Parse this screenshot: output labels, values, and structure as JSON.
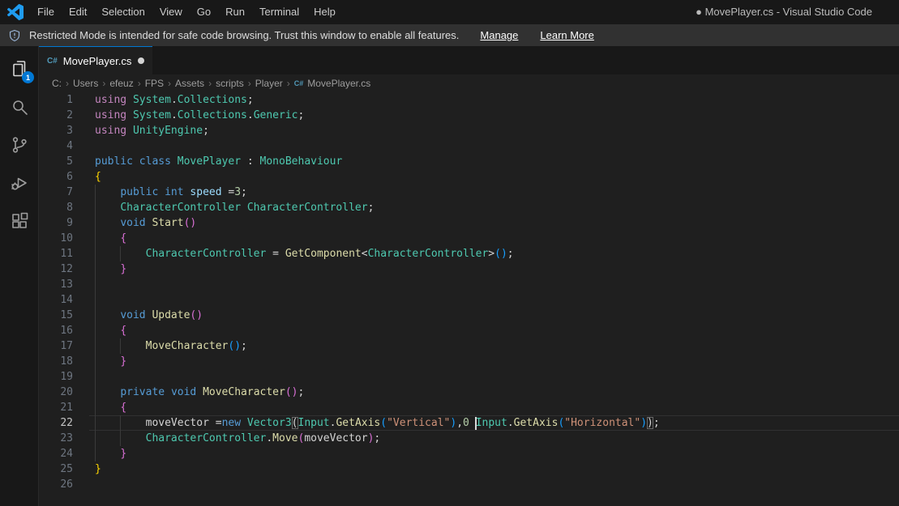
{
  "window": {
    "title": "● MovePlayer.cs - Visual Studio Code"
  },
  "menu": {
    "items": [
      "File",
      "Edit",
      "Selection",
      "View",
      "Go",
      "Run",
      "Terminal",
      "Help"
    ]
  },
  "banner": {
    "message": "Restricted Mode is intended for safe code browsing. Trust this window to enable all features.",
    "links": [
      "Manage",
      "Learn More"
    ]
  },
  "activity_bar": {
    "items": [
      "explorer",
      "search",
      "source-control",
      "run-and-debug",
      "extensions"
    ],
    "explorer_badge": "1"
  },
  "tab": {
    "label": "MovePlayer.cs",
    "icon": "csharp-file-icon",
    "modified": true
  },
  "breadcrumb": {
    "items": [
      "C:",
      "Users",
      "efeuz",
      "FPS",
      "Assets",
      "scripts",
      "Player",
      "MovePlayer.cs"
    ]
  },
  "colors": {
    "fg": "#d4d4d4",
    "kw": "#569cd6",
    "ctl": "#c586c0",
    "type": "#4ec9b0",
    "fn": "#dcdcaa",
    "str": "#ce9178",
    "num": "#b5cea8",
    "var": "#9cdcfe",
    "b1": "#ffd700",
    "b2": "#da70d6",
    "b3": "#179fff",
    "accent": "#0078d4",
    "cs_icon": "#519aba"
  },
  "editor": {
    "lines": [
      {
        "n": 1,
        "g": [],
        "t": [
          [
            "using",
            "ctl"
          ],
          [
            " ",
            "fg"
          ],
          [
            "System",
            "type"
          ],
          [
            ".",
            "fg"
          ],
          [
            "Collections",
            "type"
          ],
          [
            ";",
            "fg"
          ]
        ]
      },
      {
        "n": 2,
        "g": [],
        "t": [
          [
            "using",
            "ctl"
          ],
          [
            " ",
            "fg"
          ],
          [
            "System",
            "type"
          ],
          [
            ".",
            "fg"
          ],
          [
            "Collections",
            "type"
          ],
          [
            ".",
            "fg"
          ],
          [
            "Generic",
            "type"
          ],
          [
            ";",
            "fg"
          ]
        ]
      },
      {
        "n": 3,
        "g": [],
        "t": [
          [
            "using",
            "ctl"
          ],
          [
            " ",
            "fg"
          ],
          [
            "UnityEngine",
            "type"
          ],
          [
            ";",
            "fg"
          ]
        ]
      },
      {
        "n": 4,
        "g": [],
        "t": []
      },
      {
        "n": 5,
        "g": [],
        "t": [
          [
            "public",
            "kw"
          ],
          [
            " ",
            "fg"
          ],
          [
            "class",
            "kw"
          ],
          [
            " ",
            "fg"
          ],
          [
            "MovePlayer",
            "type"
          ],
          [
            " : ",
            "fg"
          ],
          [
            "MonoBehaviour",
            "type"
          ]
        ]
      },
      {
        "n": 6,
        "g": [],
        "t": [
          [
            "{",
            "b1"
          ]
        ]
      },
      {
        "n": 7,
        "g": [
          0
        ],
        "t": [
          [
            "    ",
            "fg"
          ],
          [
            "public",
            "kw"
          ],
          [
            " ",
            "fg"
          ],
          [
            "int",
            "kw"
          ],
          [
            " ",
            "fg"
          ],
          [
            "speed",
            "var"
          ],
          [
            " =",
            "fg"
          ],
          [
            "3",
            "num"
          ],
          [
            ";",
            "fg"
          ]
        ]
      },
      {
        "n": 8,
        "g": [
          0
        ],
        "t": [
          [
            "    ",
            "fg"
          ],
          [
            "CharacterController",
            "type"
          ],
          [
            " ",
            "fg"
          ],
          [
            "CharacterController",
            "type"
          ],
          [
            ";",
            "fg"
          ]
        ]
      },
      {
        "n": 9,
        "g": [
          0
        ],
        "t": [
          [
            "    ",
            "fg"
          ],
          [
            "void",
            "kw"
          ],
          [
            " ",
            "fg"
          ],
          [
            "Start",
            "fn"
          ],
          [
            "(",
            "b2"
          ],
          [
            ")",
            "b2"
          ]
        ]
      },
      {
        "n": 10,
        "g": [
          0
        ],
        "t": [
          [
            "    ",
            "fg"
          ],
          [
            "{",
            "b2"
          ]
        ]
      },
      {
        "n": 11,
        "g": [
          0,
          4
        ],
        "t": [
          [
            "        ",
            "fg"
          ],
          [
            "CharacterController",
            "type"
          ],
          [
            " = ",
            "fg"
          ],
          [
            "GetComponent",
            "fn"
          ],
          [
            "<",
            "fg"
          ],
          [
            "CharacterController",
            "type"
          ],
          [
            ">",
            "fg"
          ],
          [
            "(",
            "b3"
          ],
          [
            ")",
            "b3"
          ],
          [
            ";",
            "fg"
          ]
        ]
      },
      {
        "n": 12,
        "g": [
          0
        ],
        "t": [
          [
            "    ",
            "fg"
          ],
          [
            "}",
            "b2"
          ]
        ]
      },
      {
        "n": 13,
        "g": [
          0
        ],
        "t": []
      },
      {
        "n": 14,
        "g": [
          0
        ],
        "t": []
      },
      {
        "n": 15,
        "g": [
          0
        ],
        "t": [
          [
            "    ",
            "fg"
          ],
          [
            "void",
            "kw"
          ],
          [
            " ",
            "fg"
          ],
          [
            "Update",
            "fn"
          ],
          [
            "(",
            "b2"
          ],
          [
            ")",
            "b2"
          ]
        ]
      },
      {
        "n": 16,
        "g": [
          0
        ],
        "t": [
          [
            "    ",
            "fg"
          ],
          [
            "{",
            "b2"
          ]
        ]
      },
      {
        "n": 17,
        "g": [
          0,
          4
        ],
        "t": [
          [
            "        ",
            "fg"
          ],
          [
            "MoveCharacter",
            "fn"
          ],
          [
            "(",
            "b3"
          ],
          [
            ")",
            "b3"
          ],
          [
            ";",
            "fg"
          ]
        ]
      },
      {
        "n": 18,
        "g": [
          0
        ],
        "t": [
          [
            "    ",
            "fg"
          ],
          [
            "}",
            "b2"
          ]
        ]
      },
      {
        "n": 19,
        "g": [
          0
        ],
        "t": []
      },
      {
        "n": 20,
        "g": [
          0
        ],
        "t": [
          [
            "    ",
            "fg"
          ],
          [
            "private",
            "kw"
          ],
          [
            " ",
            "fg"
          ],
          [
            "void",
            "kw"
          ],
          [
            " ",
            "fg"
          ],
          [
            "MoveCharacter",
            "fn"
          ],
          [
            "(",
            "b2"
          ],
          [
            ")",
            "b2"
          ],
          [
            ";",
            "fg"
          ]
        ]
      },
      {
        "n": 21,
        "g": [
          0
        ],
        "t": [
          [
            "    ",
            "fg"
          ],
          [
            "{",
            "b2"
          ]
        ]
      },
      {
        "n": 22,
        "g": [
          0,
          4
        ],
        "cur": true,
        "t": [
          [
            "        ",
            "fg"
          ],
          [
            "moveVector",
            "fg"
          ],
          [
            " =",
            "fg"
          ],
          [
            "new",
            "kw"
          ],
          [
            " ",
            "fg"
          ],
          [
            "Vector3",
            "type"
          ],
          [
            "(",
            "fg",
            1
          ],
          [
            "Input",
            "type"
          ],
          [
            ".",
            "fg"
          ],
          [
            "GetAxis",
            "fn"
          ],
          [
            "(",
            "b3"
          ],
          [
            "\"Vertical\"",
            "str"
          ],
          [
            ")",
            "b3"
          ],
          [
            ",",
            "fg"
          ],
          [
            "0",
            "num"
          ],
          [
            " ",
            "fg"
          ],
          [
            "",
            "cursor"
          ],
          [
            "Input",
            "type"
          ],
          [
            ".",
            "fg"
          ],
          [
            "GetAxis",
            "fn"
          ],
          [
            "(",
            "b3"
          ],
          [
            "\"Horizontal\"",
            "str"
          ],
          [
            ")",
            "b3"
          ],
          [
            ")",
            "fg",
            1
          ],
          [
            ";",
            "fg"
          ]
        ]
      },
      {
        "n": 23,
        "g": [
          0,
          4
        ],
        "t": [
          [
            "        ",
            "fg"
          ],
          [
            "CharacterController",
            "type"
          ],
          [
            ".",
            "fg"
          ],
          [
            "Move",
            "fn"
          ],
          [
            "(",
            "b2"
          ],
          [
            "moveVector",
            "fg"
          ],
          [
            ")",
            "b2"
          ],
          [
            ";",
            "fg"
          ]
        ]
      },
      {
        "n": 24,
        "g": [
          0
        ],
        "t": [
          [
            "    ",
            "fg"
          ],
          [
            "}",
            "b2"
          ]
        ]
      },
      {
        "n": 25,
        "g": [],
        "t": [
          [
            "}",
            "b1"
          ]
        ]
      },
      {
        "n": 26,
        "g": [],
        "t": []
      }
    ]
  }
}
